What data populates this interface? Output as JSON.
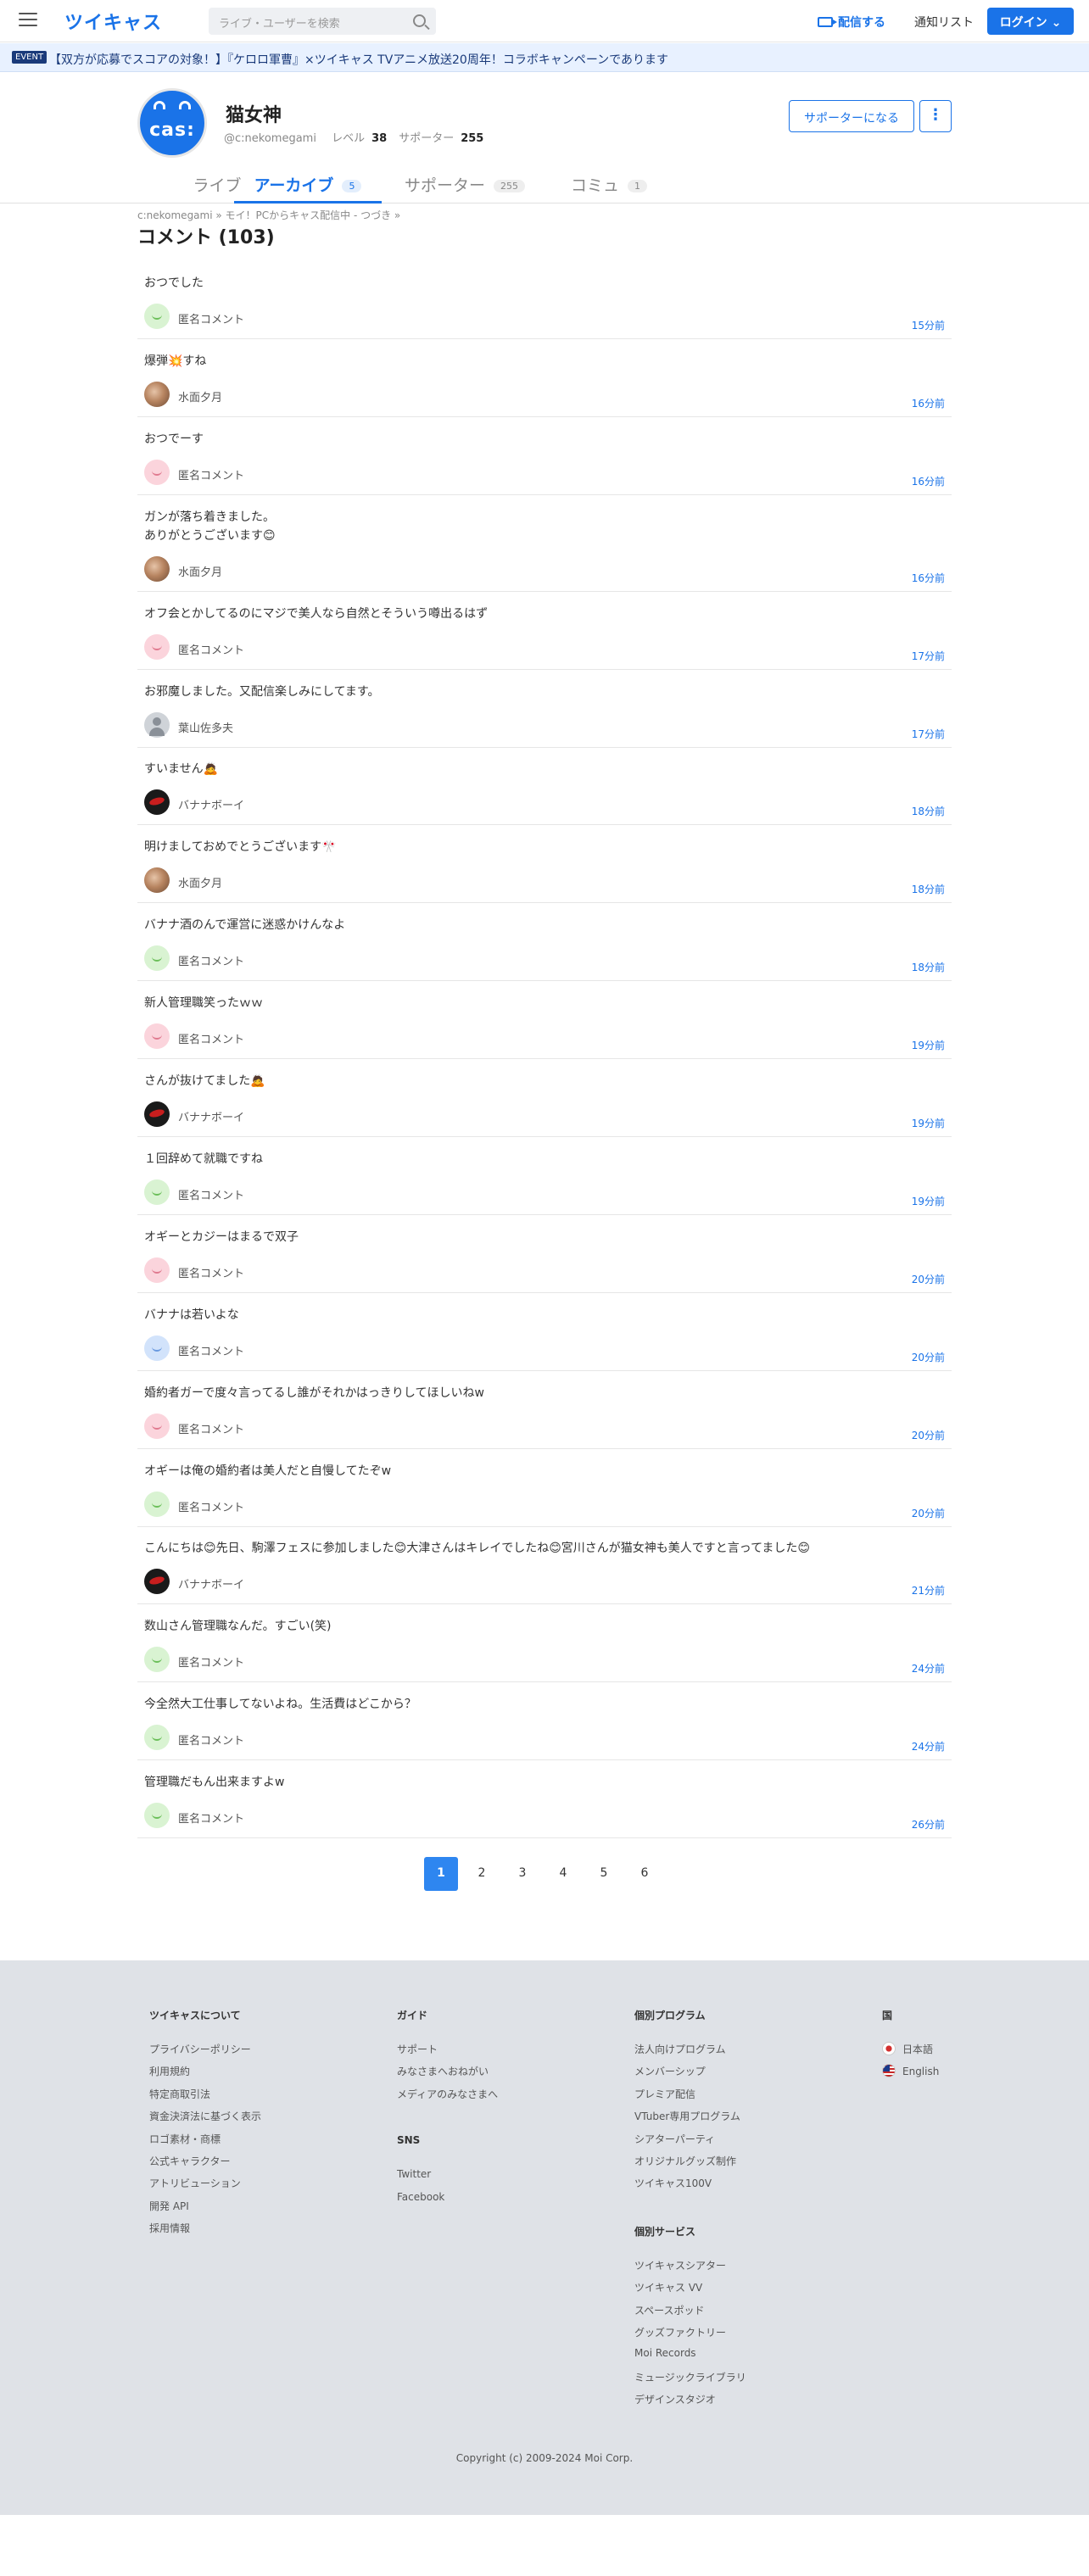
{
  "header": {
    "logo": "ツイキャス",
    "search_placeholder": "ライブ・ユーザーを検索",
    "broadcast_label": "配信する",
    "notify_label": "通知リスト",
    "login_label": "ログイン"
  },
  "event": {
    "badge": "EVENT",
    "text": "【双方が応募でスコアの対象！】『ケロロ軍曹』×ツイキャス TVアニメ放送20周年！コラボキャンペーンであります"
  },
  "profile": {
    "avatar_text": "cas:",
    "name": "猫女神",
    "handle": "@c:nekomegami",
    "level_label": "レベル",
    "level": "38",
    "supporter_label": "サポーター",
    "supporters": "255",
    "supporter_button": "サポーターになる",
    "more_button": "⋮"
  },
  "tabs": [
    {
      "label": "ライブ",
      "count": ""
    },
    {
      "label": "アーカイブ",
      "count": "5"
    },
    {
      "label": "サポーター",
      "count": "255"
    },
    {
      "label": "コミュ",
      "count": "1"
    }
  ],
  "breadcrumb": "c:nekomegami » モイ！PCからキャス配信中 - つづき »",
  "comments_title": "コメント (103)",
  "comments": [
    {
      "text": "おつでした",
      "user": "匿名コメント",
      "time": "15分前",
      "avatar": "green"
    },
    {
      "text": "爆弾💥すね",
      "user": "水面夕月",
      "time": "16分前",
      "avatar": "photo"
    },
    {
      "text": "おつでーす",
      "user": "匿名コメント",
      "time": "16分前",
      "avatar": "pink"
    },
    {
      "text": "ガンが落ち着きました。\nありがとうございます😊",
      "user": "水面夕月",
      "time": "16分前",
      "avatar": "photo"
    },
    {
      "text": "オフ会とかしてるのにマジで美人なら自然とそういう噂出るはず",
      "user": "匿名コメント",
      "time": "17分前",
      "avatar": "pink"
    },
    {
      "text": "お邪魔しました。又配信楽しみにしてます。",
      "user": "葉山佐多夫",
      "time": "17分前",
      "avatar": "grey"
    },
    {
      "text": "すいません🙇",
      "user": "バナナボーイ",
      "time": "18分前",
      "avatar": "dark"
    },
    {
      "text": "明けましておめでとうございます🎌",
      "user": "水面夕月",
      "time": "18分前",
      "avatar": "photo"
    },
    {
      "text": "バナナ酒のんで運営に迷惑かけんなよ",
      "user": "匿名コメント",
      "time": "18分前",
      "avatar": "green"
    },
    {
      "text": "新人管理職笑ったｗｗ",
      "user": "匿名コメント",
      "time": "19分前",
      "avatar": "pink"
    },
    {
      "text": "さんが抜けてました🙇",
      "user": "バナナボーイ",
      "time": "19分前",
      "avatar": "dark"
    },
    {
      "text": "１回辞めて就職ですね",
      "user": "匿名コメント",
      "time": "19分前",
      "avatar": "green"
    },
    {
      "text": "オギーとカジーはまるで双子",
      "user": "匿名コメント",
      "time": "20分前",
      "avatar": "pink"
    },
    {
      "text": "バナナは若いよな",
      "user": "匿名コメント",
      "time": "20分前",
      "avatar": "blue"
    },
    {
      "text": "婚約者ガーで度々言ってるし誰がそれかはっきりしてほしいねw",
      "user": "匿名コメント",
      "time": "20分前",
      "avatar": "pink"
    },
    {
      "text": "オギーは俺の婚約者は美人だと自慢してたぞw",
      "user": "匿名コメント",
      "time": "20分前",
      "avatar": "green"
    },
    {
      "text": "こんにちは😊先日、駒澤フェスに参加しました😊大津さんはキレイでしたね😊宮川さんが猫女神も美人ですと言ってました😊",
      "user": "バナナボーイ",
      "time": "21分前",
      "avatar": "dark"
    },
    {
      "text": "数山さん管理職なんだ。すごい(笑)",
      "user": "匿名コメント",
      "time": "24分前",
      "avatar": "green"
    },
    {
      "text": "今全然大工仕事してないよね。生活費はどこから？",
      "user": "匿名コメント",
      "time": "24分前",
      "avatar": "green"
    },
    {
      "text": "管理職だもん出来ますよw",
      "user": "匿名コメント",
      "time": "26分前",
      "avatar": "green"
    }
  ],
  "pagination": [
    "1",
    "2",
    "3",
    "4",
    "5",
    "6"
  ],
  "footer": {
    "about": {
      "title": "ツイキャスについて",
      "links": [
        "プライバシーポリシー",
        "利用規約",
        "特定商取引法",
        "資金決済法に基づく表示",
        "ロゴ素材・商標",
        "公式キャラクター",
        "アトリビューション",
        "開発 API",
        "採用情報"
      ]
    },
    "guide": {
      "title": "ガイド",
      "links": [
        "サポート",
        "みなさまへおねがい",
        "メディアのみなさまへ"
      ]
    },
    "sns": {
      "title": "SNS",
      "links": [
        "Twitter",
        "Facebook"
      ]
    },
    "programs": {
      "title": "個別プログラム",
      "links": [
        "法人向けプログラム",
        "メンバーシップ",
        "プレミア配信",
        "VTuber専用プログラム",
        "シアターパーティ",
        "オリジナルグッズ制作",
        "ツイキャス100V"
      ]
    },
    "services": {
      "title": "個別サービス",
      "links": [
        "ツイキャスシアター",
        "ツイキャス VV",
        "スペースポッド",
        "グッズファクトリー",
        "Moi Records",
        "ミュージックライブラリ",
        "デザインスタジオ"
      ]
    },
    "country": {
      "title": "国",
      "links": [
        "日本語",
        "English"
      ]
    },
    "copyright": "Copyright (c) 2009-2024 Moi Corp."
  }
}
